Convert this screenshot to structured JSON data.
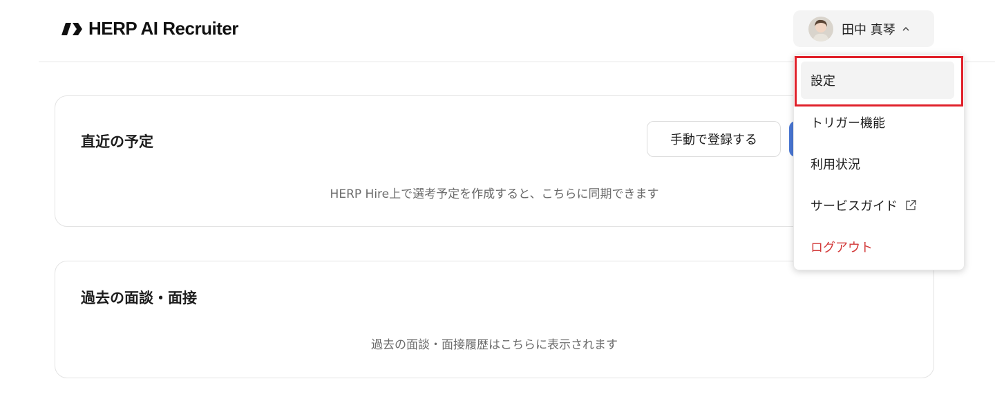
{
  "header": {
    "logo_text": "HERP AI Recruiter",
    "user_name": "田中 真琴",
    "caret": "^"
  },
  "schedule": {
    "title": "直近の予定",
    "manual_button": "手動で登録する",
    "empty_text": "HERP Hire上で選考予定を作成すると、こちらに同期できます"
  },
  "history": {
    "title": "過去の面談・面接",
    "empty_text": "過去の面談・面接履歴はこちらに表示されます"
  },
  "menu": {
    "items": [
      {
        "label": "設定"
      },
      {
        "label": "トリガー機能"
      },
      {
        "label": "利用状況"
      },
      {
        "label": "サービスガイド"
      },
      {
        "label": "ログアウト"
      }
    ]
  },
  "colors": {
    "accent_blue": "#4a78d6",
    "logout_red": "#d33a3a",
    "highlight_red": "#e0202a"
  }
}
